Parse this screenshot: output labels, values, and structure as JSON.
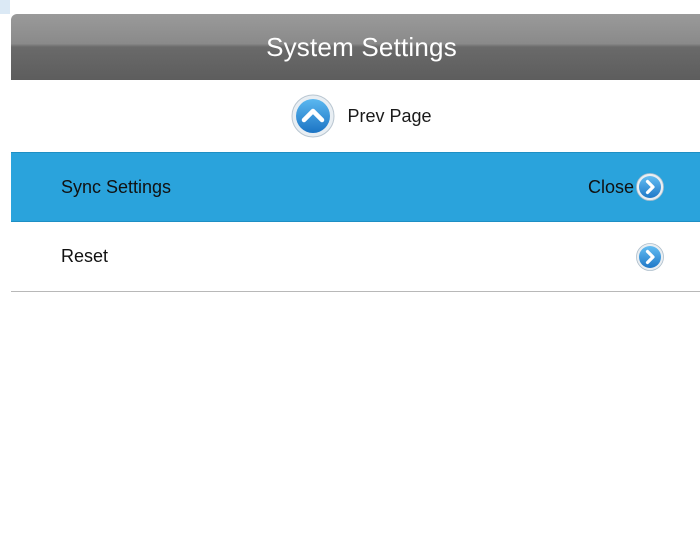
{
  "header": {
    "title": "System Settings"
  },
  "prev_page": {
    "label": "Prev Page",
    "icon": "chevron-up-circle-icon"
  },
  "menu": {
    "items": [
      {
        "label": "Sync Settings",
        "value": "Close",
        "selected": true,
        "icon": "chevron-right-circle-icon"
      },
      {
        "label": "Reset",
        "value": "",
        "selected": false,
        "icon": "chevron-right-circle-icon"
      }
    ]
  },
  "colors": {
    "title_bar": "#6f6f6f",
    "selected_row": "#2aa3dc",
    "icon_blue": "#2b8fd8"
  }
}
